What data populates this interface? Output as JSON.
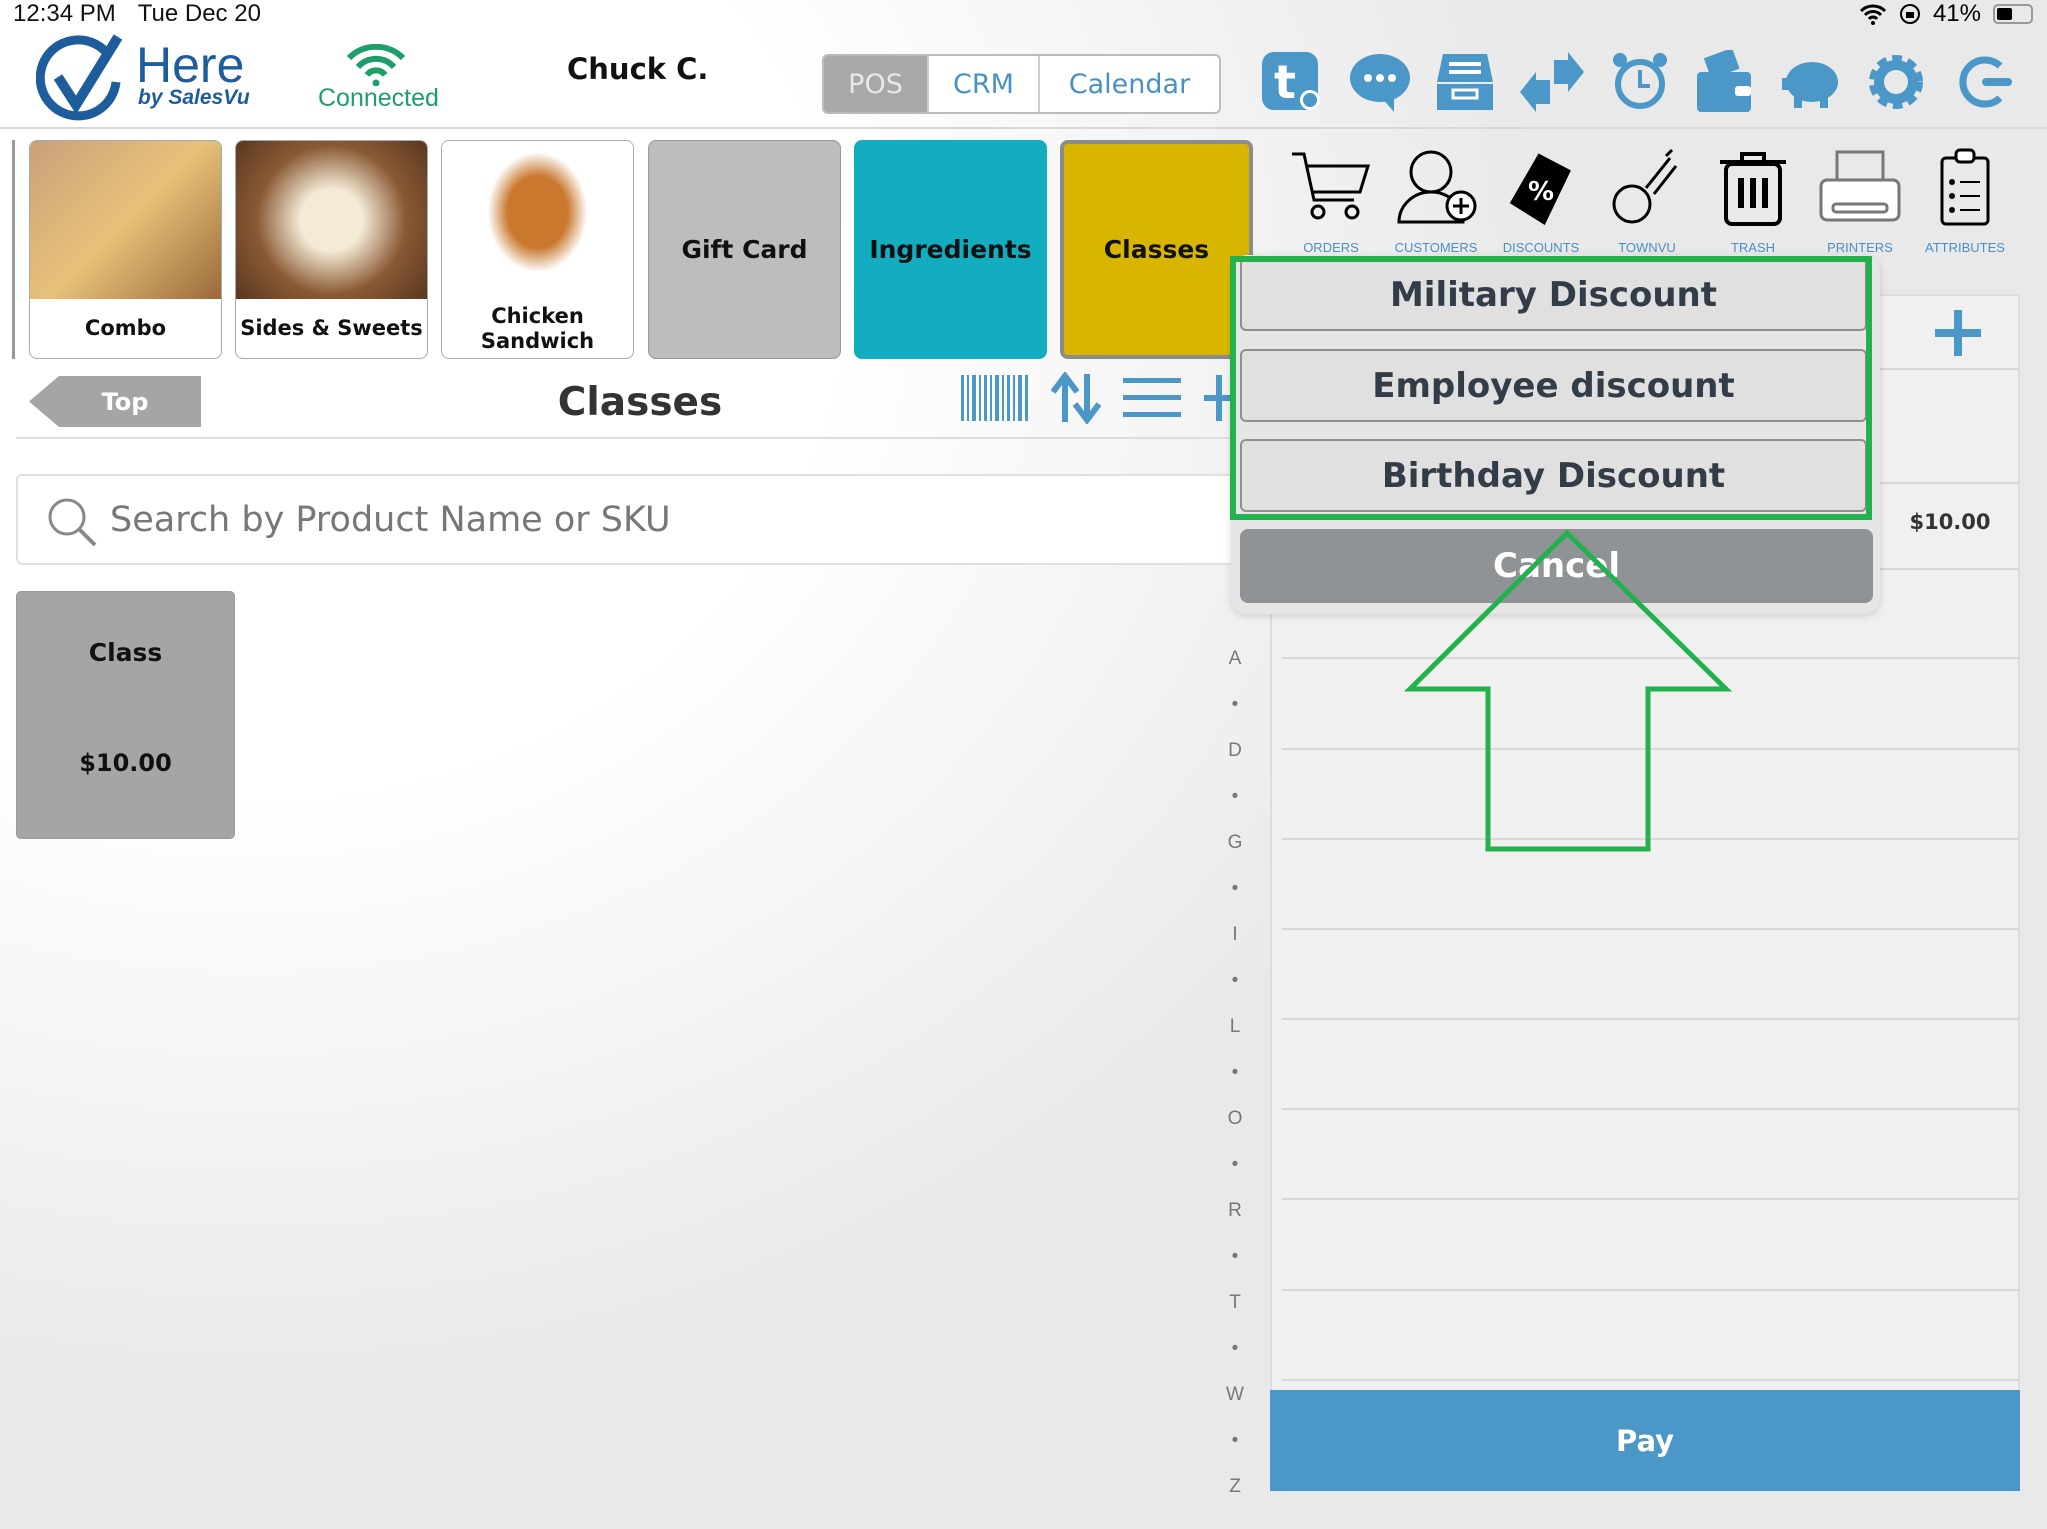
{
  "status_bar": {
    "time": "12:34 PM",
    "date": "Tue Dec 20",
    "battery": "41%",
    "battery_level": 0.41
  },
  "header": {
    "logo": {
      "name": "Here",
      "sub": "by SalesVu"
    },
    "connection_status": "Connected",
    "user": "Chuck C.",
    "mode_tabs": [
      {
        "label": "POS",
        "active": true
      },
      {
        "label": "CRM",
        "active": false
      },
      {
        "label": "Calendar",
        "active": false
      }
    ],
    "toolbar_icons": [
      "townvu-settings-icon",
      "chat-icon",
      "drawer-icon",
      "transfer-icon",
      "alarm-clock-icon",
      "wallet-icon",
      "piggy-bank-icon",
      "gear-icon",
      "logout-icon"
    ],
    "accent": "#4a97c8"
  },
  "categories": [
    {
      "label": "Combo",
      "type": "image"
    },
    {
      "label": "Sides & Sweets",
      "type": "image"
    },
    {
      "label": "Chicken Sandwich",
      "type": "image"
    },
    {
      "label": "Gift Card",
      "color": "#bdbdbd"
    },
    {
      "label": "Ingredients",
      "color": "#12adbf"
    },
    {
      "label": "Classes",
      "color": "#d8b600"
    }
  ],
  "actions": [
    {
      "label": "ORDERS",
      "icon": "cart-icon"
    },
    {
      "label": "CUSTOMERS",
      "icon": "add-user-icon"
    },
    {
      "label": "DISCOUNTS",
      "icon": "discount-tag-icon"
    },
    {
      "label": "TOWNVU",
      "icon": "townvu-icon"
    },
    {
      "label": "TRASH",
      "icon": "trash-icon"
    },
    {
      "label": "PRINTERS",
      "icon": "printer-icon"
    },
    {
      "label": "ATTRIBUTES",
      "icon": "clipboard-icon"
    }
  ],
  "nav": {
    "back_label": "Top",
    "title": "Classes"
  },
  "search": {
    "placeholder": "Search by Product Name or SKU",
    "value": ""
  },
  "products": [
    {
      "name": "Class",
      "price": "$10.00"
    }
  ],
  "cart": {
    "item_price": "$10.00",
    "pay_label": "Pay"
  },
  "alpha_index": [
    "A",
    "•",
    "D",
    "•",
    "G",
    "•",
    "I",
    "•",
    "L",
    "•",
    "O",
    "•",
    "R",
    "•",
    "T",
    "•",
    "W",
    "•",
    "Z"
  ],
  "discount_popover": {
    "options": [
      "Military Discount",
      "Employee discount",
      "Birthday Discount"
    ],
    "cancel_label": "Cancel",
    "highlight_color": "#22b14c"
  }
}
